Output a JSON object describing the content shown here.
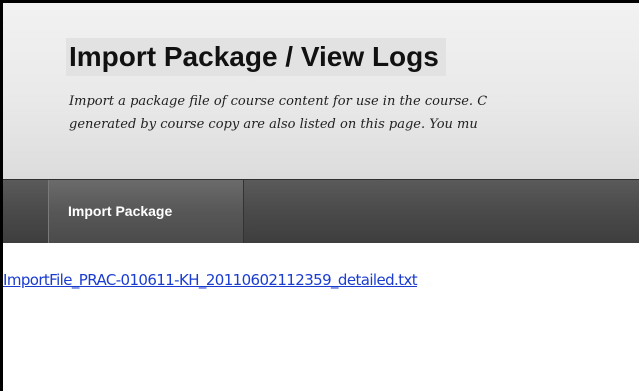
{
  "page": {
    "title": "Import Package / View Logs",
    "description_lines": [
      "Import a package file of course content for use in the course. C",
      "generated by course copy are also listed on this page. You mu"
    ]
  },
  "toolbar": {
    "tabs": [
      {
        "label": "Import Package"
      }
    ]
  },
  "logs": {
    "files": [
      {
        "name": "ImportFile_PRAC-010611-KH_20110602112359_detailed.txt"
      }
    ]
  },
  "colors": {
    "header_background": "#e9e9e9",
    "tab_bar_background": "#4a4a4a",
    "tab_text": "#ffffff",
    "link": "#1a3ccf"
  }
}
